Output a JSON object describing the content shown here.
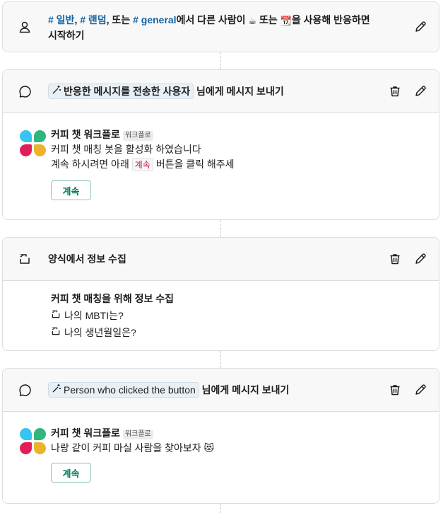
{
  "trigger": {
    "channel1": "# 일반",
    "sep1": ", ",
    "channel2": "# 랜덤",
    "sep2": ", 또는 ",
    "channel3": "# general",
    "text1": "에서 다른 사람이 ",
    "emoji1": "☕",
    "text2": " 또는 ",
    "emoji2": "📆",
    "text3": "을 사용해 반응하면",
    "line2": "시작하기"
  },
  "step1": {
    "token": "반응한 메시지를 전송한 사용자",
    "suffix": " 님에게 메시지 보내기",
    "sender": "커피 챗 워크플로",
    "sender_tag": "워크플로",
    "line1": "커피 챗 매칭 봇을 활성화 하였습니다",
    "line2_pre": "계속 하시려면 아래 ",
    "line2_code": "계속",
    "line2_post": "  버튼을 클릭 해주세",
    "button": "계속"
  },
  "step2": {
    "title": "양식에서 정보 수집",
    "form_title": "커피 챗 매칭을 위해 정보 수집",
    "questions": [
      "나의 MBTI는?",
      "나의 생년월일은?"
    ]
  },
  "step3": {
    "token": "Person who clicked the button",
    "suffix": " 님에게 메시지 보내기",
    "sender": "커피 챗 워크플로",
    "sender_tag": "워크플로",
    "line1": "나랑 같이 커피 마실 사람을 찾아보자 ",
    "emoji": "😻",
    "button": "계속"
  },
  "colors": {
    "logo_blue": "#36c5f0",
    "logo_green": "#2eb67d",
    "logo_red": "#e01e5a",
    "logo_yellow": "#ecb22e",
    "link": "#1264a3",
    "button_green": "#007a5a"
  },
  "icons": {
    "trigger": "person-icon",
    "message": "speech-bubble-icon",
    "form": "form-icon",
    "delete": "trash-icon",
    "edit": "pencil-icon",
    "token": "magic-wand-icon"
  }
}
